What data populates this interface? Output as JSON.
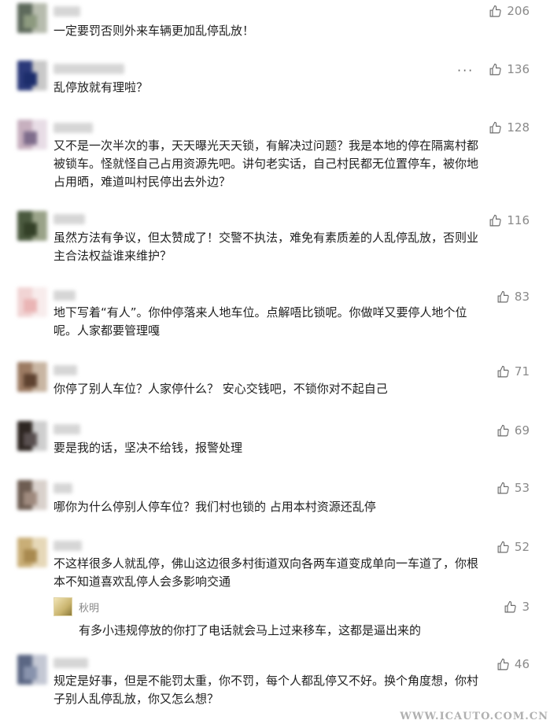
{
  "comments": [
    {
      "text": "一定要罚否则外来车辆更加乱停乱放！",
      "likes": "206",
      "avatar": [
        "#5e6a5c",
        "#b7bcae",
        "#8d9a7f"
      ]
    },
    {
      "text": "乱停放就有理啦？",
      "likes": "136",
      "more": "···",
      "avatar": [
        "#2b3a7a",
        "#c9c9c9",
        "#1c2d6b"
      ]
    },
    {
      "text": "又不是一次半次的事，天天曝光天天锁，有解决过问题？我是本地的停在隔离村都\n被锁车。怪就怪自己占用资源先吧。讲句老实话，自己村民都无位置停车，被你地\n占用晒，难道叫村民停出去外边？",
      "likes": "128",
      "avatar": [
        "#c7b0bf",
        "#e8dde6",
        "#7f6d8c"
      ]
    },
    {
      "text": "虽然方法有争议，但太赞成了！交警不执法，难免有素质差的人乱停乱放，否则业\n主合法权益谁来维护？",
      "likes": "116",
      "avatar": [
        "#4b5a3f",
        "#9aa389",
        "#334027"
      ]
    },
    {
      "text": "地下写着“有人”。你仲停落来人地车位。点解唔比锁呢。你做咩又要停人地个位\n呢。人家都要管理嘎",
      "likes": "83",
      "avatar": [
        "#f1d4d4",
        "#f8ecec",
        "#eab5b5"
      ]
    },
    {
      "text": "你停了别人车位？人家停什么？ 安心交钱吧，不锁你对不起自己",
      "likes": "71",
      "avatar": [
        "#9c7b63",
        "#c9b6a3",
        "#5e4230"
      ]
    },
    {
      "text": "要是我的话，坚决不给钱，报警处理",
      "likes": "69",
      "avatar": [
        "#2e2622",
        "#cfcfcf",
        "#595050"
      ]
    },
    {
      "text": "哪你为什么停别人停车位？我们村也锁的 占用本村资源还乱停",
      "likes": "53",
      "avatar": [
        "#6e5d52",
        "#d9d1cc",
        "#9f8a7e"
      ]
    },
    {
      "text": "不这样很多人就乱停，佛山这边很多村街道双向各两车道变成单向一车道了，你根\n本不知道喜欢乱停人会多影响交通",
      "likes": "52",
      "avatar": [
        "#c9ae77",
        "#e6d8b8",
        "#a98a4f"
      ],
      "reply": {
        "name": "秋明",
        "text": "有多小违规停放的你打了电话就会马上过来移车，这都是逼出来的",
        "likes": "3"
      }
    },
    {
      "text": "规定是好事，但是不能罚太重，你不罚，每个人都乱停又不好。换个角度想，你村\n子别人乱停乱放，你又怎么想？",
      "likes": "46",
      "avatar": [
        "#5b6784",
        "#c4c8d4",
        "#8893ad"
      ]
    }
  ],
  "watermark": "WWW.ICAUTO.COM.CN",
  "icons": {
    "like": "thumbs-up-icon"
  }
}
